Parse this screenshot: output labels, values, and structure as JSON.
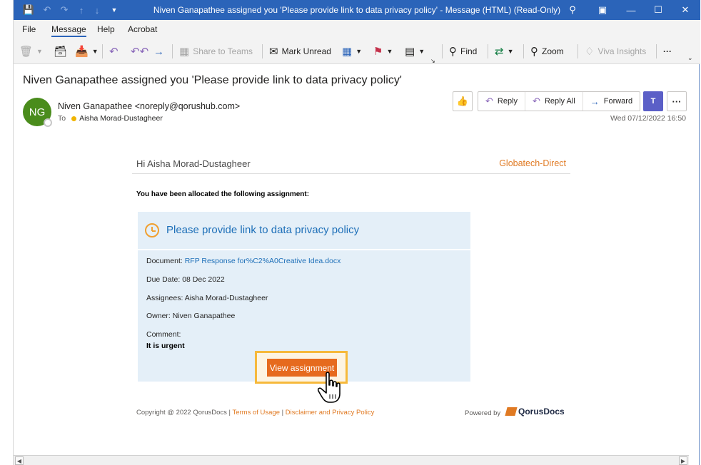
{
  "titlebar": {
    "title": "Niven Ganapathee assigned you 'Please provide link to data privacy policy'  -  Message (HTML) (Read-Only)"
  },
  "menu": {
    "file": "File",
    "message": "Message",
    "help": "Help",
    "acrobat": "Acrobat"
  },
  "ribbon": {
    "share_to_teams": "Share to Teams",
    "mark_unread": "Mark Unread",
    "find": "Find",
    "zoom": "Zoom",
    "viva_insights": "Viva Insights",
    "more": "···"
  },
  "header": {
    "subject": "Niven Ganapathee assigned you 'Please provide link to data privacy policy'",
    "avatar_initials": "NG",
    "from": "Niven Ganapathee <noreply@qorushub.com>",
    "to_label": "To",
    "to_recipient": "Aisha Morad-Dustagheer",
    "date": "Wed 07/12/2022 16:50",
    "reply": "Reply",
    "reply_all": "Reply All",
    "forward": "Forward",
    "more": "···"
  },
  "email": {
    "greeting": "Hi Aisha Morad-Dustagheer",
    "brand": "Globatech-Direct",
    "allocation_text": "You have been allocated the following assignment:",
    "card_title": "Please provide link to data privacy policy",
    "document_label": "Document:",
    "document_link": "RFP Response for%C2%A0Creative Idea.docx",
    "due_date": "Due Date: 08 Dec 2022",
    "assignees": "Assignees: Aisha Morad-Dustagheer",
    "owner": "Owner: Niven Ganapathee",
    "comment_label": "Comment:",
    "comment_value": "It is urgent",
    "view_button": "View assignment"
  },
  "footer": {
    "copyright": "Copyright @ 2022 QorusDocs",
    "sep1": "|",
    "terms": "Terms of Usage",
    "sep2": "|",
    "disclaimer": "Disclaimer and Privacy Policy",
    "powered_by": "Powered by",
    "logo_text": "QorusDocs"
  },
  "colors": {
    "titlebar": "#2b64b9",
    "avatar": "#4a8c1c",
    "accent_orange": "#e66a1e",
    "link_blue": "#1d6fb8",
    "card_bg": "#e4eff8"
  }
}
